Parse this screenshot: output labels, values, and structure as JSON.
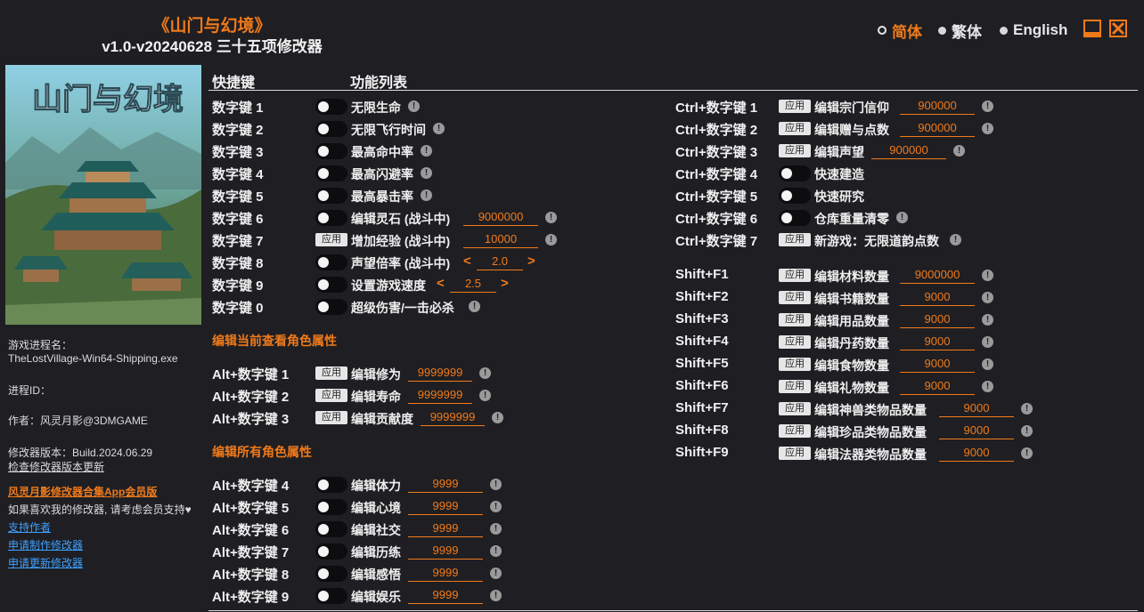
{
  "header": {
    "title": "《山门与幻境》",
    "subtitle": "v1.0-v20240628 三十五项修改器",
    "languages": [
      {
        "label": "简体",
        "active": true
      },
      {
        "label": "繁体",
        "active": false
      },
      {
        "label": "English",
        "active": false
      }
    ],
    "accent_color": "#f07a1a"
  },
  "sidebar": {
    "cover_title": "山门与幻境",
    "process_label": "游戏进程名：",
    "process_name": "TheLostVillage-Win64-Shipping.exe",
    "pid_label": "进程ID：",
    "author": "作者：风灵月影@3DMGAME",
    "version": "修改器版本：Build.2024.06.29",
    "check_update": "检查修改器版本更新",
    "app_link": "风灵月影修改器合集App会员版",
    "support_text": "如果喜欢我的修改器, 请考虑会员支持♥",
    "links": [
      "支持作者",
      "申请制作修改器",
      "申请更新修改器"
    ]
  },
  "columns": {
    "hotkey": "快捷键",
    "features": "功能列表"
  },
  "info_mark": "!",
  "apply_label": "应用",
  "left_items": [
    {
      "key": "数字键 1",
      "control": "toggle",
      "label": "无限生命",
      "info": true
    },
    {
      "key": "数字键 2",
      "control": "toggle",
      "label": "无限飞行时间",
      "info": true
    },
    {
      "key": "数字键 3",
      "control": "toggle",
      "label": "最高命中率",
      "info": true
    },
    {
      "key": "数字键 4",
      "control": "toggle",
      "label": "最高闪避率",
      "info": true
    },
    {
      "key": "数字键 5",
      "control": "toggle",
      "label": "最高暴击率",
      "info": true
    },
    {
      "key": "数字键 6",
      "control": "toggle",
      "label": "编辑灵石 (战斗中)",
      "value": "9000000",
      "info": true
    },
    {
      "key": "数字键 7",
      "control": "apply",
      "label": "增加经验 (战斗中)",
      "value": "10000",
      "info": true
    },
    {
      "key": "数字键 8",
      "control": "toggle",
      "label": "声望倍率 (战斗中)",
      "stepper": "2.0"
    },
    {
      "key": "数字键 9",
      "control": "toggle",
      "label": "设置游戏速度",
      "stepper": "2.5"
    },
    {
      "key": "数字键 0",
      "control": "toggle",
      "label": "超级伤害/一击必杀",
      "info": true
    }
  ],
  "section_current": "编辑当前查看角色属性",
  "current_items": [
    {
      "key": "Alt+数字键 1",
      "control": "apply",
      "label": "编辑修为",
      "value": "9999999",
      "info": true
    },
    {
      "key": "Alt+数字键 2",
      "control": "apply",
      "label": "编辑寿命",
      "value": "9999999",
      "info": true
    },
    {
      "key": "Alt+数字键 3",
      "control": "apply",
      "label": "编辑贡献度",
      "value": "9999999",
      "info": true
    }
  ],
  "section_all": "编辑所有角色属性",
  "all_items": [
    {
      "key": "Alt+数字键 4",
      "control": "toggle",
      "label": "编辑体力",
      "value": "9999",
      "info": true
    },
    {
      "key": "Alt+数字键 5",
      "control": "toggle",
      "label": "编辑心境",
      "value": "9999",
      "info": true
    },
    {
      "key": "Alt+数字键 6",
      "control": "toggle",
      "label": "编辑社交",
      "value": "9999",
      "info": true
    },
    {
      "key": "Alt+数字键 7",
      "control": "toggle",
      "label": "编辑历练",
      "value": "9999",
      "info": true
    },
    {
      "key": "Alt+数字键 8",
      "control": "toggle",
      "label": "编辑感悟",
      "value": "9999",
      "info": true
    },
    {
      "key": "Alt+数字键 9",
      "control": "toggle",
      "label": "编辑娱乐",
      "value": "9999",
      "info": true
    }
  ],
  "ctrl_items": [
    {
      "key": "Ctrl+数字键 1",
      "control": "apply",
      "label": "编辑宗门信仰",
      "value": "900000",
      "info": true
    },
    {
      "key": "Ctrl+数字键 2",
      "control": "apply",
      "label": "编辑赠与点数",
      "value": "900000",
      "info": true
    },
    {
      "key": "Ctrl+数字键 3",
      "control": "apply",
      "label": "编辑声望",
      "value": "900000",
      "info": true
    },
    {
      "key": "Ctrl+数字键 4",
      "control": "toggle",
      "label": "快速建造"
    },
    {
      "key": "Ctrl+数字键 5",
      "control": "toggle",
      "label": "快速研究"
    },
    {
      "key": "Ctrl+数字键 6",
      "control": "toggle",
      "label": "仓库重量清零",
      "info": true
    },
    {
      "key": "Ctrl+数字键 7",
      "control": "apply",
      "label": "新游戏：无限道韵点数",
      "info": true
    }
  ],
  "shift_items": [
    {
      "key": "Shift+F1",
      "control": "apply",
      "label": "编辑材料数量",
      "value": "9000000",
      "info": true
    },
    {
      "key": "Shift+F2",
      "control": "apply",
      "label": "编辑书籍数量",
      "value": "9000",
      "info": true
    },
    {
      "key": "Shift+F3",
      "control": "apply",
      "label": "编辑用品数量",
      "value": "9000",
      "info": true
    },
    {
      "key": "Shift+F4",
      "control": "apply",
      "label": "编辑丹药数量",
      "value": "9000",
      "info": true
    },
    {
      "key": "Shift+F5",
      "control": "apply",
      "label": "编辑食物数量",
      "value": "9000",
      "info": true
    },
    {
      "key": "Shift+F6",
      "control": "apply",
      "label": "编辑礼物数量",
      "value": "9000",
      "info": true
    },
    {
      "key": "Shift+F7",
      "control": "apply",
      "label": "编辑神兽类物品数量",
      "value": "9000",
      "info": true
    },
    {
      "key": "Shift+F8",
      "control": "apply",
      "label": "编辑珍品类物品数量",
      "value": "9000",
      "info": true
    },
    {
      "key": "Shift+F9",
      "control": "apply",
      "label": "编辑法器类物品数量",
      "value": "9000",
      "info": true
    }
  ]
}
